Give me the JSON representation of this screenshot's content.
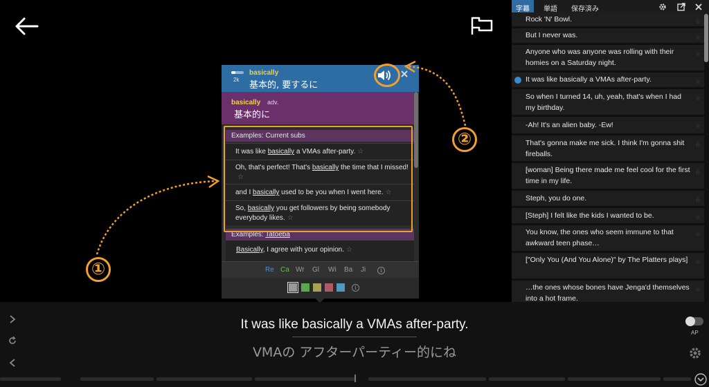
{
  "popup": {
    "header": {
      "word": "basically",
      "frequency_rank": "2k",
      "frequency_level": 0.35,
      "meaning": "基本的, 要するに"
    },
    "definition": {
      "word": "basically",
      "pos": "adv.",
      "meaning": "基本的に"
    },
    "current_subs": {
      "heading": "Examples: Current subs",
      "items": [
        {
          "pre": "It was like ",
          "word": "basically",
          "post": " a VMAs after-party."
        },
        {
          "pre": "Oh, that's perfect! That's ",
          "word": "basically",
          "post": " the time that I missed!"
        },
        {
          "pre": "and I ",
          "word": "basically",
          "post": " used to be you when I went here."
        },
        {
          "pre": "So, ",
          "word": "basically",
          "post": " you get followers by being somebody everybody likes."
        }
      ]
    },
    "tatoeba": {
      "heading_prefix": "Examples: ",
      "heading_link": "Tatoeba",
      "item": {
        "word": "Basically",
        "post": ", I agree with your opinion."
      }
    },
    "sources": [
      "Re",
      "Ca",
      "Wr",
      "Gl",
      "Wi",
      "Ba",
      "Ji"
    ],
    "source_colors": [
      "#4f8fd6",
      "#6dbb4b",
      "#9a9a9a",
      "#9a9a9a",
      "#9a9a9a",
      "#9a9a9a",
      "#9a9a9a"
    ],
    "info_glyph": "i",
    "swatch_colors": [
      "#9a9a9a",
      "#59a84e",
      "#a8a352",
      "#b05a66",
      "#4f9ab8"
    ],
    "star": "☆"
  },
  "annotations": {
    "one": "①",
    "two": "②",
    "color": "#f0a030"
  },
  "sidebar": {
    "tabs": [
      "字幕",
      "単語",
      "保存済み"
    ],
    "active_tab": 0,
    "tool_icons": [
      "gear-icon",
      "export-icon",
      "close-icon"
    ],
    "rows": [
      "Rock 'N' Bowl.",
      "But I never was.",
      "Anyone who was anyone was rolling with their homies on a Saturday night.",
      "It was like basically a VMAs after-party.",
      "So when I turned 14, uh, yeah, that's when I had my birthday.",
      "-Ah! It's an alien baby. -Ew!",
      "That's gonna make me sick. I think I'm gonna shit fireballs.",
      "[woman] Being there made me feel cool for the first time in my life.",
      "Steph, you do one.",
      "[Steph] I felt like the kids I wanted to be.",
      "You know, the ones who seem immune to that awkward teen phase…",
      "[\"Only You (And You Alone)\" by The Platters plays]",
      "…the ones whose bones have Jenga'd themselves into a hot frame."
    ],
    "current_row": 3
  },
  "subtitle": {
    "english": "It was like basically a VMAs after-party.",
    "japanese": "VMAの アフターパーティー的にね"
  },
  "controls": {
    "ap_label": "AP",
    "autopause_on": false
  }
}
